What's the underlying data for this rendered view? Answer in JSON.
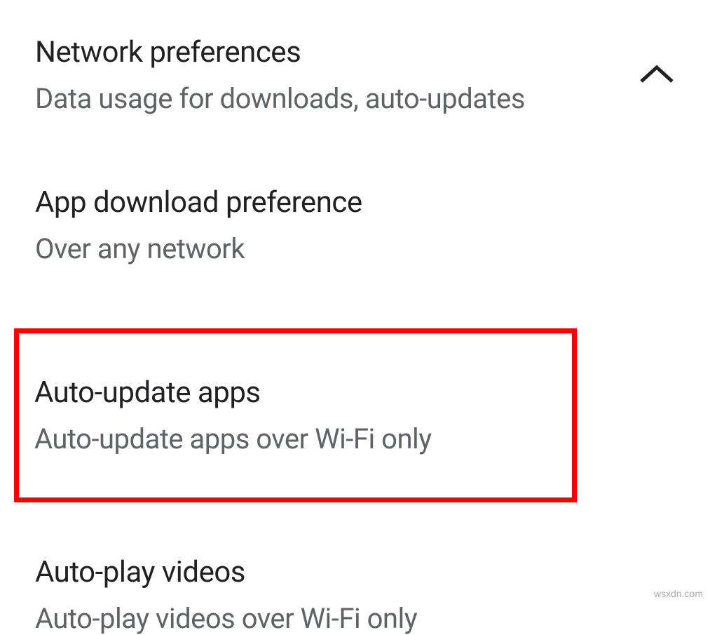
{
  "section": {
    "title": "Network preferences",
    "subtitle": "Data usage for downloads, auto-updates"
  },
  "settings": [
    {
      "title": "App download preference",
      "value": "Over any network"
    },
    {
      "title": "Auto-update apps",
      "value": "Auto-update apps over Wi-Fi only"
    },
    {
      "title": "Auto-play videos",
      "value": "Auto-play videos over Wi-Fi only"
    }
  ],
  "watermark": "wsxdn.com"
}
